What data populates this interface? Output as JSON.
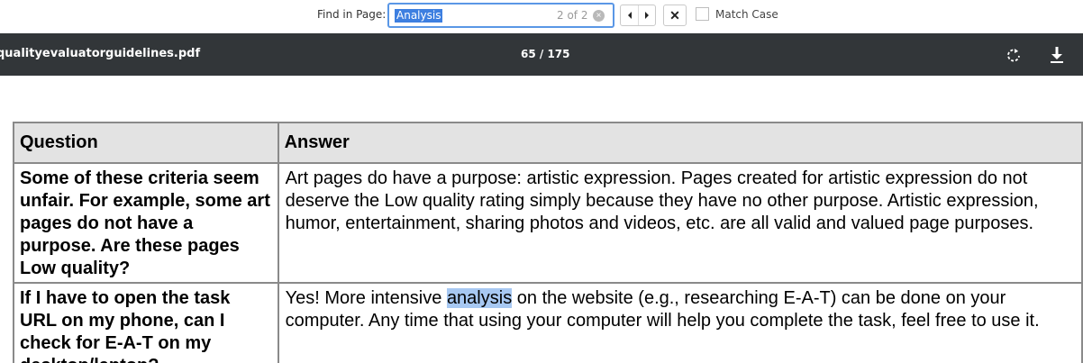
{
  "find_bar": {
    "label": "Find in Page:",
    "query": "Analysis",
    "count": "2 of 2",
    "match_case_label": "Match Case",
    "match_case_checked": false
  },
  "pdf_toolbar": {
    "filename": "qualityevaluatorguidelines.pdf",
    "page_indicator": "65 / 175"
  },
  "table": {
    "headers": {
      "question": "Question",
      "answer": "Answer"
    },
    "rows": [
      {
        "question": "Some of these criteria seem unfair.  For example, some art pages do not have a purpose.  Are these pages Low quality?",
        "answer": "Art pages do have a purpose: artistic expression.  Pages created for artistic expression do not deserve the Low quality rating simply because they have no other purpose.  Artistic expression, humor, entertainment, sharing photos and videos, etc. are all valid and valued page purposes."
      },
      {
        "question": "If I have to open the task URL on my phone, can I check for E-A-T on my desktop/laptop?",
        "answer_before": "Yes!  More intensive ",
        "answer_highlight": "analysis",
        "answer_after": " on the website (e.g., researching E-A-T) can be done on your computer.  Any time that using your computer will help you complete the task, feel free to use it."
      }
    ]
  },
  "colors": {
    "toolbar_bg": "#323639",
    "find_focus": "#5a97e6",
    "selection": "#3d7fe0",
    "search_highlight": "#a7c8f2",
    "header_bg": "#e3e3e3"
  }
}
